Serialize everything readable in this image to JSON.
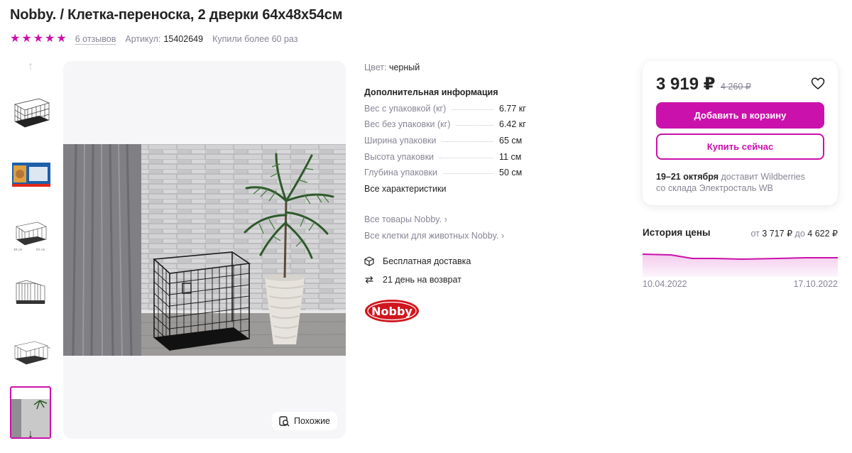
{
  "product": {
    "title": "Nobby. / Клетка-переноска, 2 дверки 64х48х54см",
    "reviews": "6 отзывов",
    "article_label": "Артикул:",
    "article_value": "15402649",
    "bought": "Купили более 60 раз",
    "rating_stars": 5
  },
  "gallery": {
    "similar_label": "Похожие",
    "active_thumb": 6
  },
  "specs": {
    "color_label": "Цвет:",
    "color_value": "черный",
    "additional_title": "Дополнительная информация",
    "params": [
      {
        "key": "Вес с упаковкой (кг)",
        "value": "6.77 кг"
      },
      {
        "key": "Вес без упаковки (кг)",
        "value": "6.42 кг"
      },
      {
        "key": "Ширина упаковки",
        "value": "65 см"
      },
      {
        "key": "Высота упаковки",
        "value": "11 см"
      },
      {
        "key": "Глубина упаковки",
        "value": "50 см"
      }
    ],
    "all_characteristics": "Все характеристики",
    "brand_links": [
      "Все товары Nobby.",
      "Все клетки для животных Nobby."
    ],
    "features": [
      "Бесплатная доставка",
      "21 день на возврат"
    ],
    "brand_logo_text": "Nobby"
  },
  "buy": {
    "price": "3 919 ₽",
    "old_price": "4 260 ₽",
    "add_to_cart": "Добавить в корзину",
    "buy_now": "Купить сейчас",
    "delivery_dates": "19–21 октября",
    "delivery_text": "доставит Wildberries",
    "warehouse": "со склада Электросталь WB"
  },
  "price_history": {
    "title": "История цены",
    "from_label": "от",
    "min": "3 717 ₽",
    "to_label": "до",
    "max": "4 622 ₽",
    "date_start": "10.04.2022",
    "date_end": "17.10.2022"
  },
  "colors": {
    "accent": "#cb11ab",
    "text": "#242424",
    "muted": "#868695"
  }
}
